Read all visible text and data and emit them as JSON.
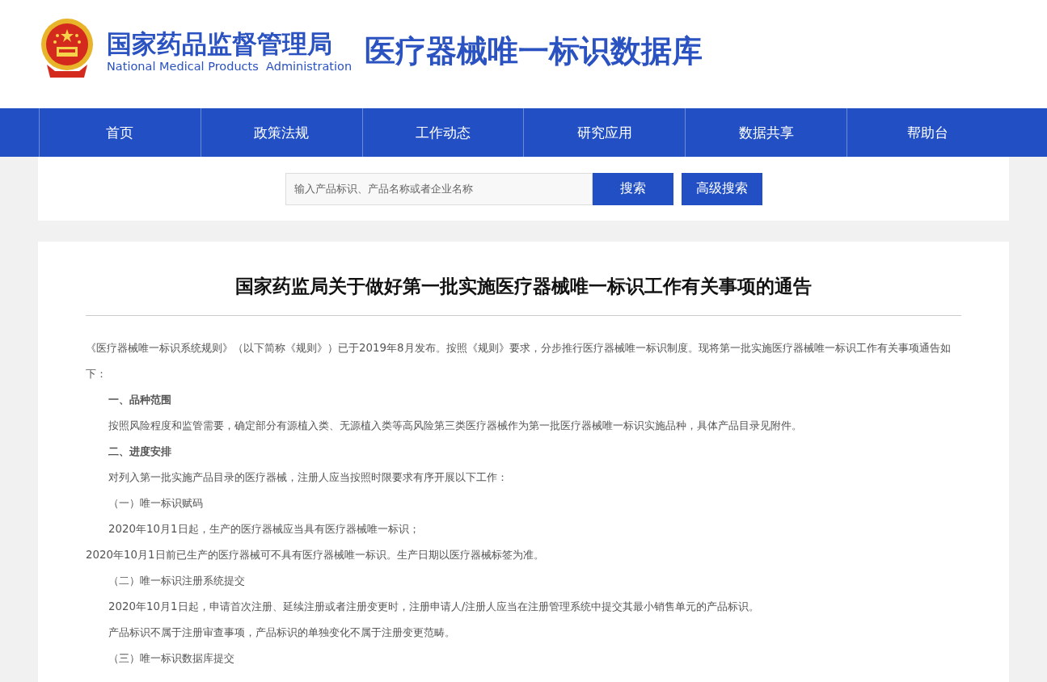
{
  "header": {
    "agency_name": "国家药品监督管理局",
    "agency_name_en": "National Medical Products  Administration",
    "site_title": "医疗器械唯一标识数据库"
  },
  "nav": [
    {
      "label": "首页"
    },
    {
      "label": "政策法规"
    },
    {
      "label": "工作动态"
    },
    {
      "label": "研究应用"
    },
    {
      "label": "数据共享"
    },
    {
      "label": "帮助台"
    }
  ],
  "search": {
    "placeholder": "输入产品标识、产品名称或者企业名称",
    "buttons": [
      "搜索",
      "高级搜索"
    ]
  },
  "article": {
    "title": "国家药监局关于做好第一批实施医疗器械唯一标识工作有关事项的通告",
    "paragraphs": [
      {
        "kind": "plain",
        "text": "《医疗器械唯一标识系统规则》（以下简称《规则》）已于2019年8月发布。按照《规则》要求，分步推行医疗器械唯一标识制度。现将第一批实施医疗器械唯一标识工作有关事项通告如下："
      },
      {
        "kind": "heading",
        "text": "一、品种范围"
      },
      {
        "kind": "indent",
        "text": "按照风险程度和监管需要，确定部分有源植入类、无源植入类等高风险第三类医疗器械作为第一批医疗器械唯一标识实施品种，具体产品目录见附件。"
      },
      {
        "kind": "heading",
        "text": "二、进度安排"
      },
      {
        "kind": "indent",
        "text": "对列入第一批实施产品目录的医疗器械，注册人应当按照时限要求有序开展以下工作："
      },
      {
        "kind": "indent",
        "text": "（一）唯一标识赋码"
      },
      {
        "kind": "indent",
        "text": "2020年10月1日起，生产的医疗器械应当具有医疗器械唯一标识；"
      },
      {
        "kind": "plain",
        "text": "2020年10月1日前已生产的医疗器械可不具有医疗器械唯一标识。生产日期以医疗器械标签为准。"
      },
      {
        "kind": "indent",
        "text": "（二）唯一标识注册系统提交"
      },
      {
        "kind": "indent",
        "text": "2020年10月1日起，申请首次注册、延续注册或者注册变更时，注册申请人/注册人应当在注册管理系统中提交其最小销售单元的产品标识。"
      },
      {
        "kind": "indent",
        "text": "产品标识不属于注册审查事项，产品标识的单独变化不属于注册变更范畴。"
      },
      {
        "kind": "indent",
        "text": "（三）唯一标识数据库提交"
      }
    ]
  }
}
